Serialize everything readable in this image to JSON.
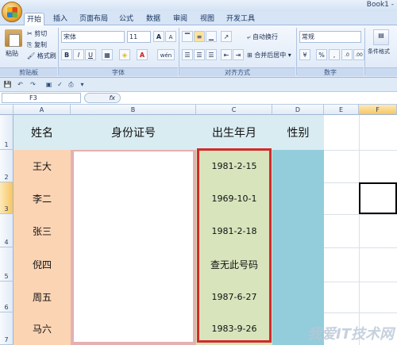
{
  "window": {
    "title": "Book1 - "
  },
  "tabs": [
    "开始",
    "插入",
    "页面布局",
    "公式",
    "数据",
    "审阅",
    "视图",
    "开发工具"
  ],
  "ribbon": {
    "clipboard": {
      "paste": "粘贴",
      "cut": "剪切",
      "copy": "复制",
      "format_painter": "格式刷",
      "label": "剪贴板"
    },
    "font": {
      "name": "宋体",
      "size": "11",
      "grow": "A",
      "shrink": "A",
      "bold": "B",
      "italic": "I",
      "underline": "U",
      "phonetic": "wén",
      "label": "字体"
    },
    "alignment": {
      "wrap": "自动换行",
      "merge": "合并后居中",
      "label": "对齐方式"
    },
    "number": {
      "format": "常规",
      "percent": "%",
      "comma": ",",
      "label": "数字"
    },
    "styles": {
      "conditional": "条件格式"
    }
  },
  "formula_bar": {
    "name_box": "F3",
    "fx": "fx"
  },
  "columns": [
    "A",
    "B",
    "C",
    "D",
    "E",
    "F"
  ],
  "rows": [
    "1",
    "2",
    "3",
    "4",
    "5",
    "6",
    "7"
  ],
  "headers": {
    "name": "姓名",
    "id": "身份证号",
    "birth": "出生年月",
    "gender": "性别"
  },
  "records": [
    {
      "name": "王大",
      "birth": "1981-2-15"
    },
    {
      "name": "李二",
      "birth": "1969-10-1"
    },
    {
      "name": "张三",
      "birth": "1981-2-18"
    },
    {
      "name": "倪四",
      "birth": "查无此号码"
    },
    {
      "name": "周五",
      "birth": "1987-6-27"
    },
    {
      "name": "马六",
      "birth": "1983-9-26"
    }
  ],
  "watermark": "我爱IT技术网",
  "colors": {
    "header_fill": "#d9ecf2",
    "name_fill": "#fbd4b4",
    "id_border": "#e3b1b2",
    "birth_fill": "#d7e4bc",
    "gender_fill": "#93cddc",
    "highlight": "#d32a2a"
  }
}
